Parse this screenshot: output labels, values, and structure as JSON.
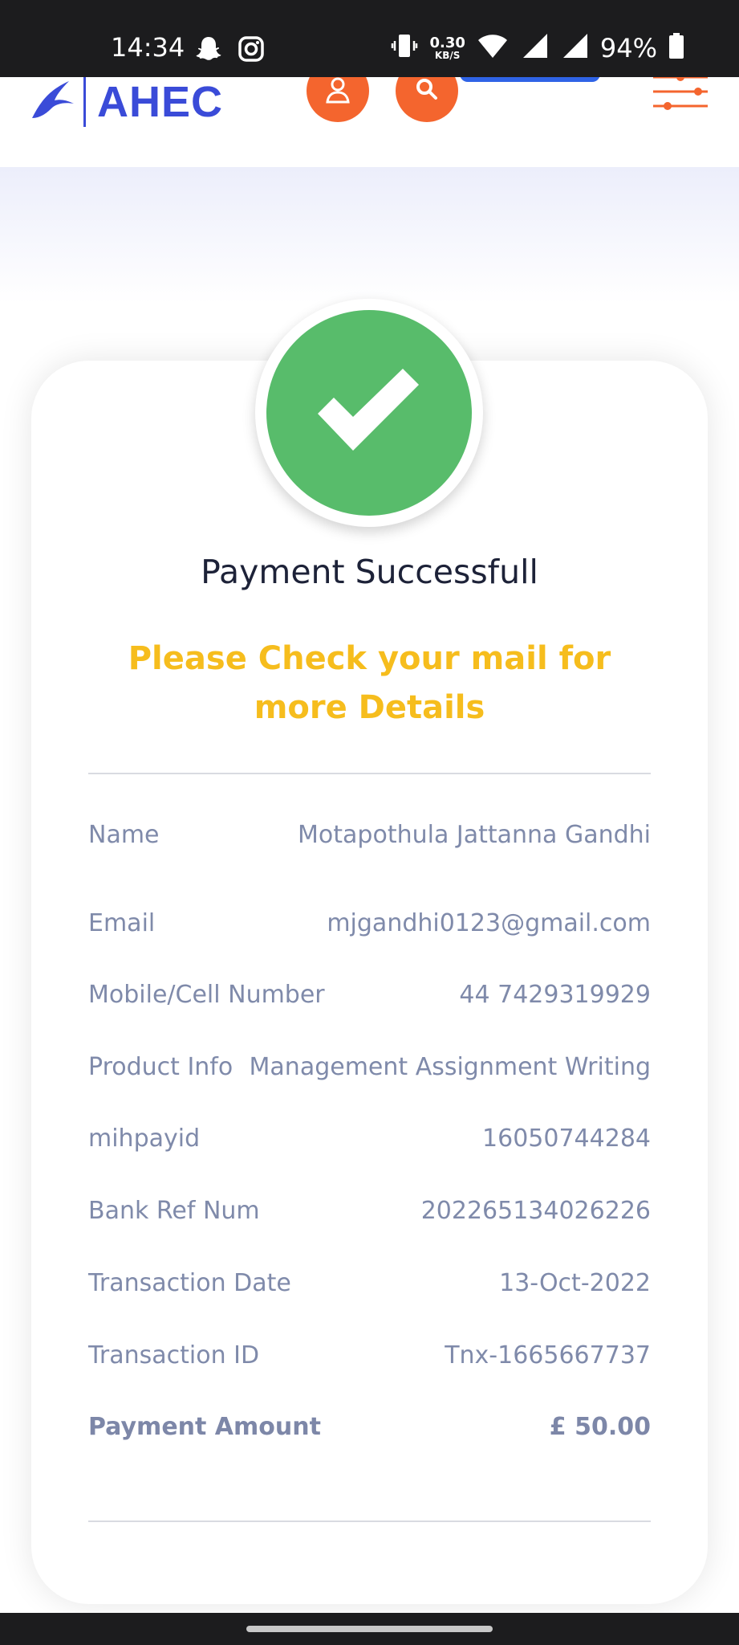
{
  "status_bar": {
    "time": "14:34",
    "net_speed_value": "0.30",
    "net_speed_unit": "KB/S",
    "battery": "94%",
    "icons": [
      "snapchat-icon",
      "instagram-icon",
      "vibrate-icon",
      "wifi-icon",
      "signal-icon",
      "signal-icon",
      "battery-icon"
    ]
  },
  "header": {
    "logo_text": "AHEC",
    "icons": [
      "swallow-logo-icon",
      "user-icon",
      "search-icon",
      "filter-menu-icon"
    ],
    "accent_color": "#3a4bd8",
    "button_color": "#f4652e"
  },
  "payment": {
    "status_title": "Payment Successfull",
    "message": "Please Check your mail for more Details",
    "success_color": "#58bc6b",
    "message_color": "#f6bd1d",
    "details": [
      {
        "label": "Name",
        "value": "Motapothula Jattanna Gandhi"
      },
      {
        "label": "Email",
        "value": "mjgandhi0123@gmail.com"
      },
      {
        "label": "Mobile/Cell Number",
        "value": "44 7429319929"
      },
      {
        "label": "Product Info",
        "value": "Management Assignment Writing"
      },
      {
        "label": "mihpayid",
        "value": "16050744284"
      },
      {
        "label": "Bank Ref Num",
        "value": "202265134026226"
      },
      {
        "label": "Transaction Date",
        "value": "13-Oct-2022"
      },
      {
        "label": "Transaction ID",
        "value": "Tnx-1665667737"
      },
      {
        "label": "Payment Amount",
        "value": "£ 50.00"
      }
    ]
  }
}
